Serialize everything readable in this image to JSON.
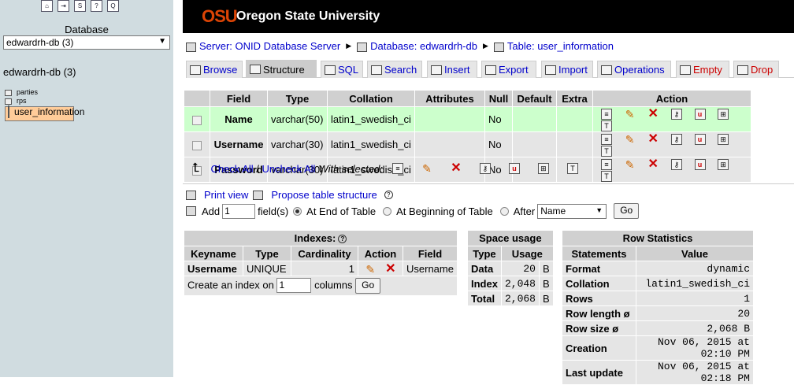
{
  "left": {
    "top_icons": [
      "home-icon",
      "logout-icon",
      "sql-icon",
      "help-icon",
      "query-icon"
    ],
    "database_label": "Database",
    "database_select": "edwardrh-db (3)",
    "db_name": "edwardrh-db (3)",
    "tables": [
      "parties",
      "rps",
      "user_information"
    ]
  },
  "header": {
    "logo": "OSU",
    "title": "Oregon State University"
  },
  "breadcrumb": {
    "server": "Server: ONID Database Server",
    "database": "Database: edwardrh-db",
    "table": "Table: user_information"
  },
  "tabs": [
    "Browse",
    "Structure",
    "SQL",
    "Search",
    "Insert",
    "Export",
    "Import",
    "Operations",
    "Empty",
    "Drop"
  ],
  "structure": {
    "headers": [
      "Field",
      "Type",
      "Collation",
      "Attributes",
      "Null",
      "Default",
      "Extra",
      "Action"
    ],
    "rows": [
      {
        "field": "Name",
        "type": "varchar(50)",
        "collation": "latin1_swedish_ci",
        "attributes": "",
        "null": "No",
        "default": "",
        "extra": ""
      },
      {
        "field": "Username",
        "type": "varchar(30)",
        "collation": "latin1_swedish_ci",
        "attributes": "",
        "null": "No",
        "default": "",
        "extra": ""
      },
      {
        "field": "Password",
        "type": "varchar(30)",
        "collation": "latin1_swedish_ci",
        "attributes": "",
        "null": "No",
        "default": "",
        "extra": ""
      }
    ]
  },
  "with_selected": {
    "check_all": "Check All",
    "sep": " / ",
    "uncheck_all": "Uncheck All",
    "label": "With selected:"
  },
  "print_view": "Print view",
  "propose": "Propose table structure",
  "add": {
    "label": "Add",
    "value": "1",
    "fields": "field(s)",
    "end": "At End of Table",
    "beginning": "At Beginning of Table",
    "after": "After",
    "after_select": "Name",
    "go": "Go"
  },
  "indexes": {
    "title": "Indexes:",
    "headers": [
      "Keyname",
      "Type",
      "Cardinality",
      "Action",
      "Field"
    ],
    "row": {
      "keyname": "Username",
      "type": "UNIQUE",
      "cardinality": "1",
      "field": "Username"
    },
    "create_prefix": "Create an index on",
    "create_value": "1",
    "create_suffix": "columns",
    "go": "Go"
  },
  "space": {
    "title": "Space usage",
    "headers": [
      "Type",
      "Usage"
    ],
    "rows": [
      {
        "type": "Data",
        "usage": "20",
        "unit": "B"
      },
      {
        "type": "Index",
        "usage": "2,048",
        "unit": "B"
      },
      {
        "type": "Total",
        "usage": "2,068",
        "unit": "B"
      }
    ]
  },
  "rowstats": {
    "title": "Row Statistics",
    "headers": [
      "Statements",
      "Value"
    ],
    "rows": [
      {
        "k": "Format",
        "v": "dynamic"
      },
      {
        "k": "Collation",
        "v": "latin1_swedish_ci"
      },
      {
        "k": "Rows",
        "v": "1"
      },
      {
        "k": "Row length ø",
        "v": "20"
      },
      {
        "k": "Row size ø",
        "v": "2,068 B"
      },
      {
        "k": "Creation",
        "v": "Nov 06, 2015 at 02:10 PM"
      },
      {
        "k": "Last update",
        "v": "Nov 06, 2015 at 02:18 PM"
      }
    ]
  }
}
